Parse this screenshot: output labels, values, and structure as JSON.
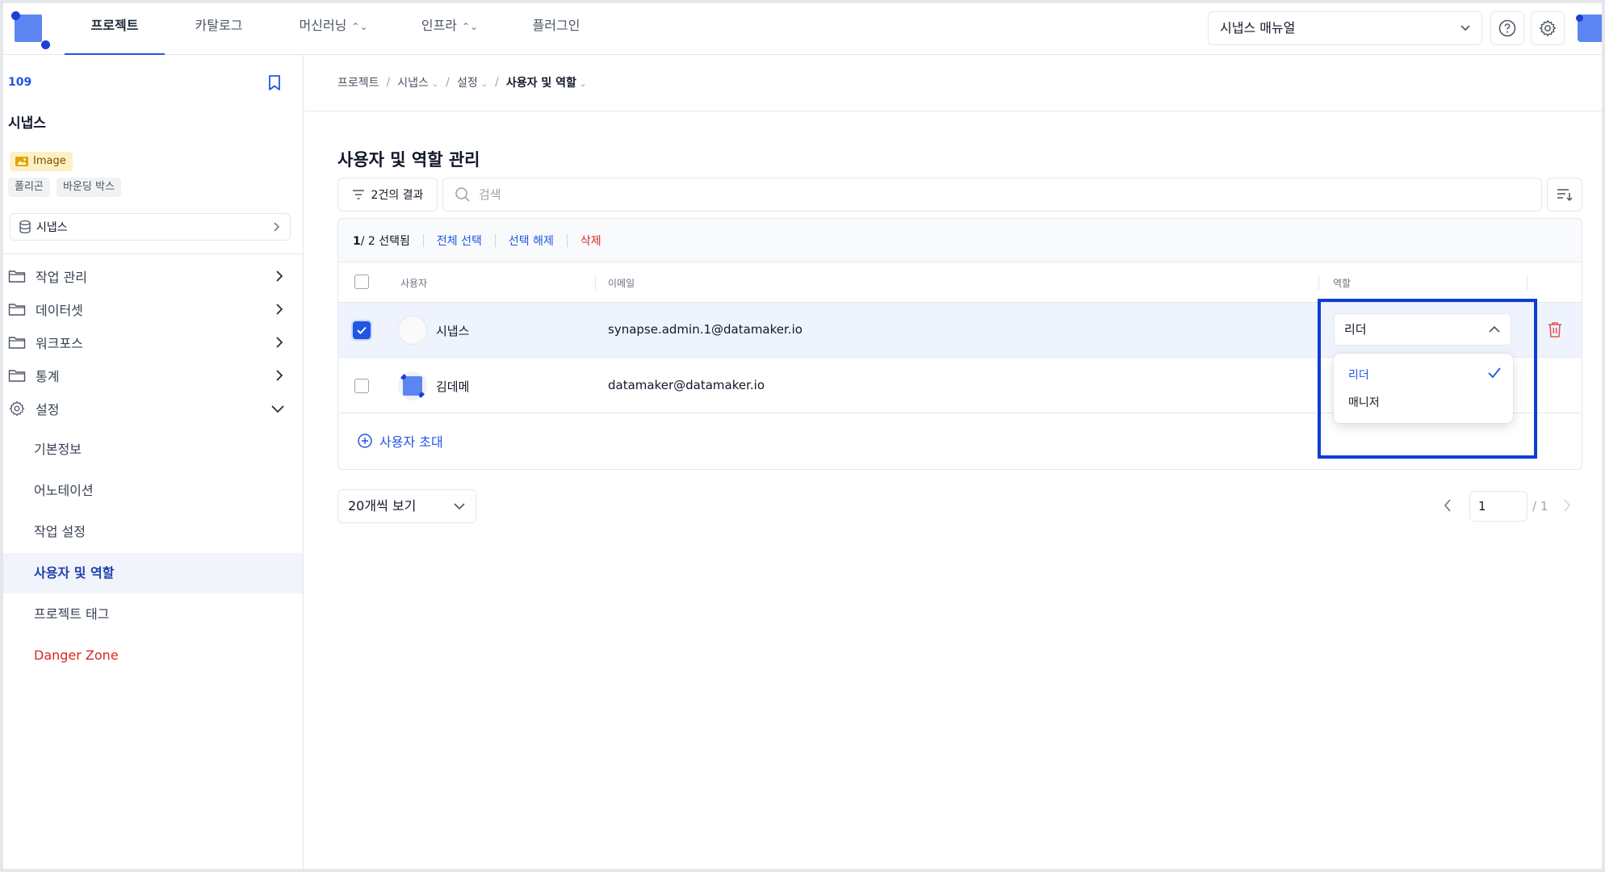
{
  "nav": {
    "tabs": [
      {
        "label": "프로젝트",
        "active": true
      },
      {
        "label": "카탈로그"
      },
      {
        "label": "머신러닝",
        "dropdown": true
      },
      {
        "label": "인프라",
        "dropdown": true
      },
      {
        "label": "플러그인"
      }
    ],
    "manual_select": "시냅스 매뉴얼",
    "icons": [
      "help-icon",
      "settings-icon"
    ]
  },
  "sidebar": {
    "project_id": "109",
    "project_name": "시냅스",
    "data_type_badge": "Image",
    "tags": [
      "폴리곤",
      "바운딩 박스"
    ],
    "dataset": "시냅스",
    "items": [
      {
        "label": "작업 관리",
        "icon": "folder-icon"
      },
      {
        "label": "데이터셋",
        "icon": "folder-icon"
      },
      {
        "label": "워크포스",
        "icon": "folder-icon"
      },
      {
        "label": "통계",
        "icon": "folder-icon"
      },
      {
        "label": "설정",
        "icon": "gear-icon",
        "expanded": true
      }
    ],
    "settings_sub": [
      {
        "label": "기본정보"
      },
      {
        "label": "어노테이션"
      },
      {
        "label": "작업 설정"
      },
      {
        "label": "사용자 및 역할",
        "active": true
      },
      {
        "label": "프로젝트 태그"
      },
      {
        "label": "Danger Zone",
        "danger": true
      }
    ]
  },
  "breadcrumb": [
    "프로젝트",
    "시냅스",
    "설정",
    "사용자 및 역할"
  ],
  "page": {
    "title": "사용자 및 역할 관리",
    "filter_result": "2건의 결과",
    "search_placeholder": "검색"
  },
  "selection_bar": {
    "selected": "1",
    "total": "/ 2 선택됨",
    "select_all": "전체 선택",
    "deselect": "선택 해제",
    "delete": "삭제"
  },
  "table": {
    "headers": {
      "user": "사용자",
      "email": "이메일",
      "role": "역할"
    },
    "rows": [
      {
        "name": "시냅스",
        "email": "synapse.admin.1@datamaker.io",
        "role": "리더",
        "checked": true
      },
      {
        "name": "김데메",
        "email": "datamaker@datamaker.io",
        "checked": false
      }
    ]
  },
  "role_menu": {
    "options": [
      {
        "label": "리더",
        "selected": true
      },
      {
        "label": "매니저",
        "selected": false
      }
    ]
  },
  "invite_label": "사용자 초대",
  "pagination": {
    "page_size": "20개씩 보기",
    "current": "1",
    "total": "/ 1"
  },
  "colors": {
    "accent": "#2155e6",
    "danger": "#dc2626",
    "highlight": "#0a3fd6"
  }
}
